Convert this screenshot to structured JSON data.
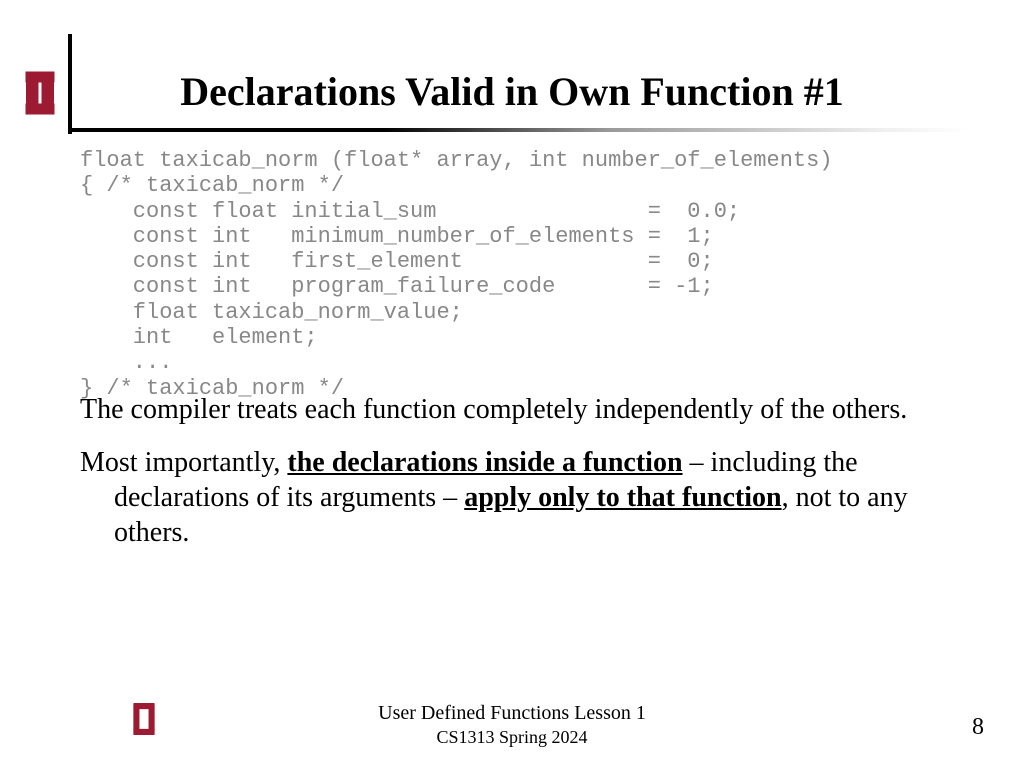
{
  "title": "Declarations Valid in Own Function #1",
  "code": {
    "l1": "float taxicab_norm (float* array, int number_of_elements)",
    "l2": "{ /* taxicab_norm */",
    "l3": "    const float initial_sum                =  0.0;",
    "l4": "    const int   minimum_number_of_elements =  1;",
    "l5": "    const int   first_element              =  0;",
    "l6": "    const int   program_failure_code       = -1;",
    "l7": "    float taxicab_norm_value;",
    "l8": "    int   element;",
    "l9": "    ...",
    "l10": "} /* taxicab_norm */"
  },
  "para1": "The compiler treats each function completely independently of the others.",
  "para2": {
    "a": "Most importantly, ",
    "b": "the declarations inside a function",
    "c": " – including the declarations of its arguments – ",
    "d": "apply only to that function",
    "e": ", not to any others."
  },
  "footer": {
    "line1": "User Defined Functions Lesson 1",
    "line2": "CS1313 Spring 2024"
  },
  "page": "8"
}
